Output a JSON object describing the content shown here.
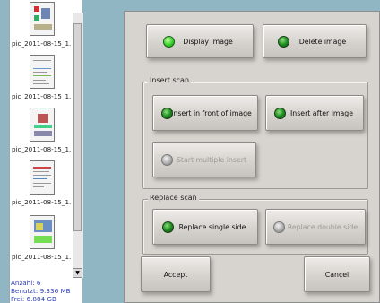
{
  "thumbnails": {
    "items": [
      {
        "name": "pic_2011-08-15_1...",
        "kind": "photo"
      },
      {
        "name": "pic_2011-08-15_1...",
        "kind": "document"
      },
      {
        "name": "pic_2011-08-15_1...",
        "kind": "photo"
      },
      {
        "name": "pic_2011-08-15_1...",
        "kind": "document"
      },
      {
        "name": "pic_2011-08-15_1...",
        "kind": "photo"
      }
    ],
    "status": {
      "count": "Anzahl: 6",
      "used": "Benutzt: 9.336 MB",
      "free": "Frei: 6.884 GB"
    }
  },
  "controls": {
    "display_image": "Display image",
    "delete_image": "Delete image",
    "insert_scan": {
      "title": "Insert scan",
      "insert_front": "Insert in front of image",
      "insert_after": "Insert after image",
      "start_multiple": "Start multiple insert"
    },
    "replace_scan": {
      "title": "Replace scan",
      "replace_single": "Replace single side",
      "replace_double": "Replace double side"
    },
    "accept": "Accept",
    "cancel": "Cancel"
  },
  "colors": {
    "background": "#8fb6c2",
    "panel": "#d7d4cf",
    "led_active": "#34d22a",
    "status_text": "#2d3dbb"
  }
}
